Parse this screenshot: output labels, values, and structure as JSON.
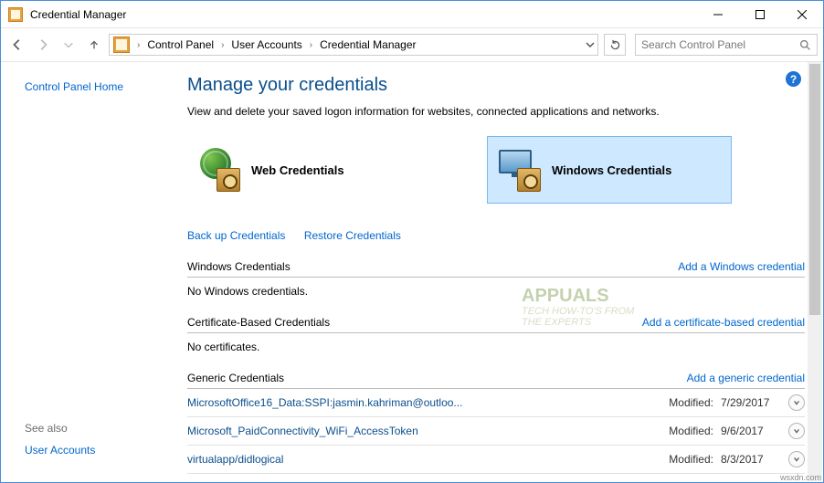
{
  "window": {
    "title": "Credential Manager"
  },
  "breadcrumb": {
    "items": [
      "Control Panel",
      "User Accounts",
      "Credential Manager"
    ]
  },
  "search": {
    "placeholder": "Search Control Panel"
  },
  "sidebar": {
    "home": "Control Panel Home",
    "see_also_label": "See also",
    "see_also_link": "User Accounts"
  },
  "main": {
    "heading": "Manage your credentials",
    "subheading": "View and delete your saved logon information for websites, connected applications and networks.",
    "tiles": {
      "web": "Web Credentials",
      "windows": "Windows Credentials"
    },
    "links": {
      "backup": "Back up Credentials",
      "restore": "Restore Credentials"
    },
    "modified_label": "Modified:",
    "sections": {
      "windows": {
        "label": "Windows Credentials",
        "action": "Add a Windows credential",
        "empty": "No Windows credentials."
      },
      "cert": {
        "label": "Certificate-Based Credentials",
        "action": "Add a certificate-based credential",
        "empty": "No certificates."
      },
      "generic": {
        "label": "Generic Credentials",
        "action": "Add a generic credential",
        "entries": [
          {
            "name": "MicrosoftOffice16_Data:SSPI:jasmin.kahriman@outloo...",
            "date": "7/29/2017"
          },
          {
            "name": "Microsoft_PaidConnectivity_WiFi_AccessToken",
            "date": "9/6/2017"
          },
          {
            "name": "virtualapp/didlogical",
            "date": "8/3/2017"
          }
        ]
      }
    }
  },
  "footer_mark": "wsxdn.com"
}
